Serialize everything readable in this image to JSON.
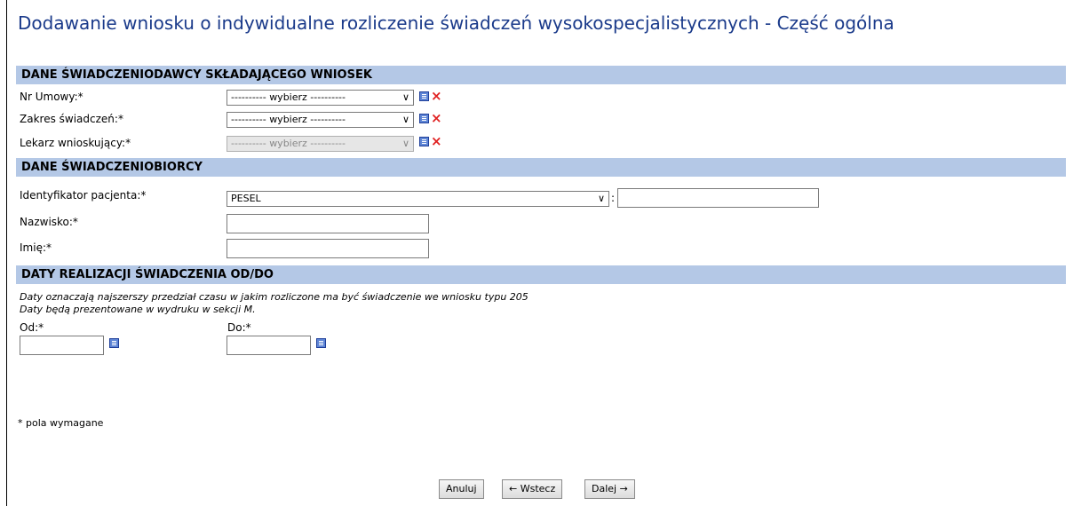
{
  "title": "Dodawanie wniosku o indywidualne rozliczenie świadczeń wysokospecjalistycznych - Część ogólna",
  "sections": {
    "provider": {
      "header": "DANE ŚWIADCZENIODAWCY SKŁADAJĄCEGO WNIOSEK",
      "fields": [
        {
          "label": "Nr Umowy:*",
          "value": "---------- wybierz ----------"
        },
        {
          "label": "Zakres świadczeń:*",
          "value": "---------- wybierz ----------"
        },
        {
          "label": "Lekarz wnioskujący:*",
          "value": "---------- wybierz ----------"
        }
      ]
    },
    "patient": {
      "header": "DANE ŚWIADCZENIOBIORCY",
      "identifier_label": "Identyfikator pacjenta:*",
      "identifier_type": "PESEL",
      "colon": ":",
      "surname_label": "Nazwisko:*",
      "firstname_label": "Imię:*"
    },
    "dates": {
      "header": "DATY REALIZACJI ŚWIADCZENIA OD/DO",
      "note1": "Daty oznaczają najszerszy przedział czasu w jakim rozliczone ma być świadczenie we wniosku typu 205",
      "note2": "Daty będą prezentowane w wydruku w sekcji M.",
      "from_label": "Od:*",
      "to_label": "Do:*"
    }
  },
  "footnote": "* pola wymagane",
  "buttons": {
    "cancel": "Anuluj",
    "back": "← Wstecz",
    "next": "Dalej →"
  },
  "colors": {
    "title": "#1a3a8a",
    "section_bg": "#b4c8e6",
    "delete_icon": "#e02020"
  }
}
